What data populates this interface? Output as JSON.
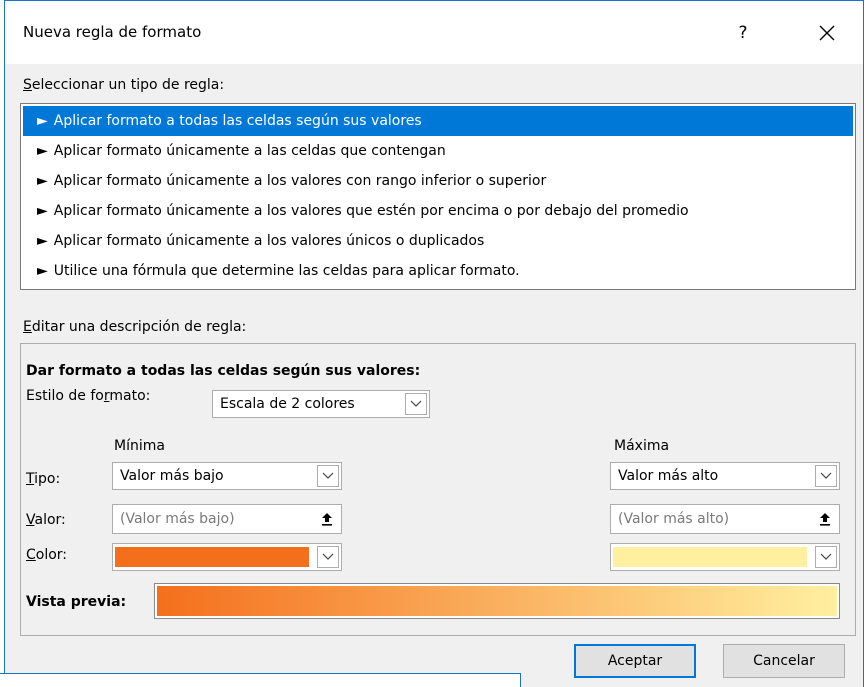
{
  "dialog": {
    "title": "Nueva regla de formato",
    "help_label": "?"
  },
  "rule_type": {
    "label_first": "S",
    "label_rest": "eleccionar un tipo de regla:",
    "bullet": "►",
    "items": [
      "Aplicar formato a todas las celdas según sus valores",
      "Aplicar formato únicamente a las celdas que contengan",
      "Aplicar formato únicamente a los valores con rango inferior o superior",
      "Aplicar formato únicamente a los valores que estén por encima o por debajo del promedio",
      "Aplicar formato únicamente a los valores únicos o duplicados",
      "Utilice una fórmula que determine las celdas para aplicar formato."
    ],
    "selected_index": 0
  },
  "description": {
    "label_first": "E",
    "label_rest": "ditar una descripción de regla:",
    "heading": "Dar formato a todas las celdas según sus valores:",
    "style_label_a": "Estilo de fo",
    "style_label_u": "r",
    "style_label_b": "mato:",
    "style_value": "Escala de 2 colores",
    "min_header": "Mínima",
    "max_header": "Máxima",
    "tipo_u": "T",
    "tipo_rest": "ipo:",
    "valor_u": "V",
    "valor_rest": "alor:",
    "color_u": "C",
    "color_rest": "olor:",
    "min_type": "Valor más bajo",
    "max_type": "Valor más alto",
    "min_value_placeholder": "(Valor más bajo)",
    "max_value_placeholder": "(Valor más alto)",
    "min_color": "#f46f1c",
    "max_color": "#fff0a0",
    "preview_label": "Vista previa:"
  },
  "buttons": {
    "ok": "Aceptar",
    "cancel": "Cancelar"
  }
}
